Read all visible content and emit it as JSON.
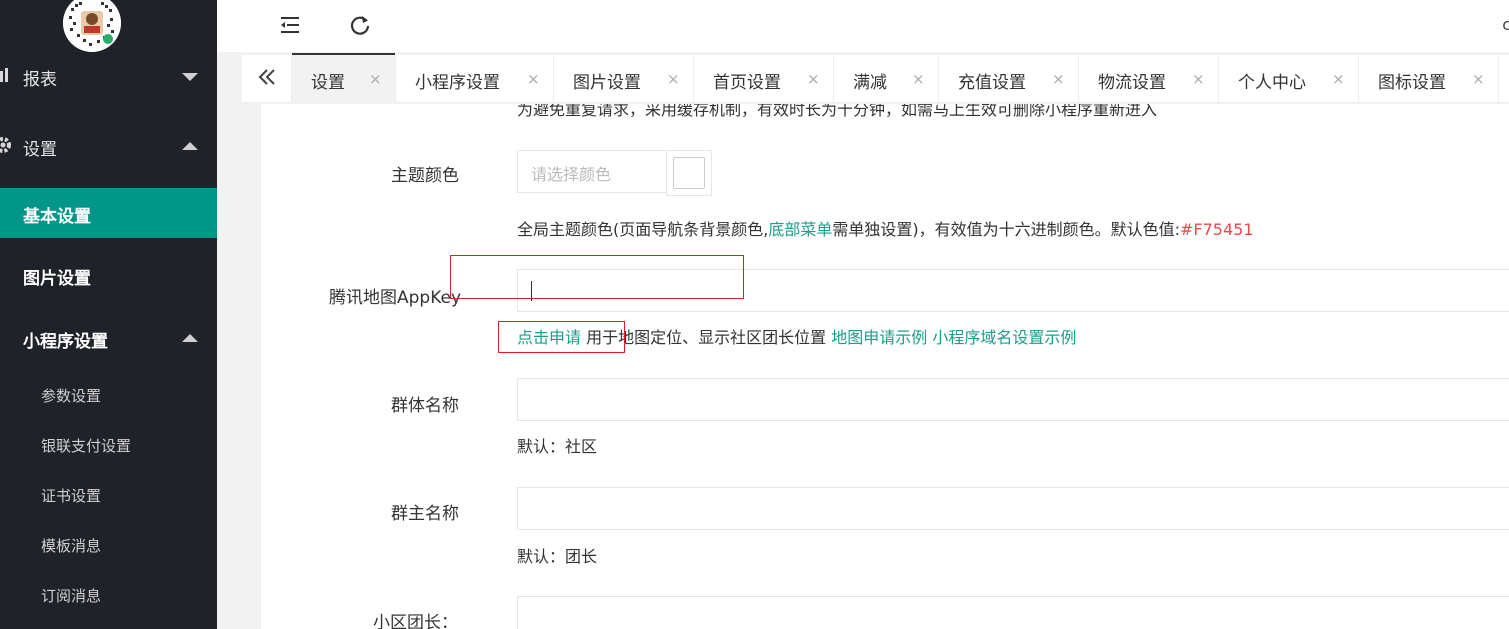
{
  "sidebar": {
    "items": [
      {
        "label": "报表"
      },
      {
        "label": "设置"
      },
      {
        "label": "基本设置"
      },
      {
        "label": "图片设置"
      },
      {
        "label": "小程序设置"
      },
      {
        "label": "参数设置"
      },
      {
        "label": "银联支付设置"
      },
      {
        "label": "证书设置"
      },
      {
        "label": "模板消息"
      },
      {
        "label": "订阅消息"
      }
    ]
  },
  "header": {
    "edge_text": "c"
  },
  "tabs": [
    {
      "label": "设置"
    },
    {
      "label": "小程序设置"
    },
    {
      "label": "图片设置"
    },
    {
      "label": "首页设置"
    },
    {
      "label": "满减"
    },
    {
      "label": "充值设置"
    },
    {
      "label": "物流设置"
    },
    {
      "label": "个人中心"
    },
    {
      "label": "图标设置"
    }
  ],
  "tab_close_glyph": "×",
  "form": {
    "cut_top_text": "为避免重复请求，采用缓存机制，有效时长为十分钟，如需马上生效可删除小程序重新进入",
    "theme_color": {
      "label": "主题颜色",
      "placeholder": "请选择颜色",
      "help_pre": "全局主题颜色(页面导航条背景颜色,",
      "help_link": "底部菜单",
      "help_mid": "需单独设置)，有效值为十六进制颜色。默认色值:",
      "help_value": "#F75451"
    },
    "map_key": {
      "label": "腾讯地图AppKey",
      "link_apply": "点击申请",
      "help_mid": "用于地图定位、显示社区团长位置",
      "link_example": "地图申请示例",
      "link_domain": "小程序域名设置示例"
    },
    "group_name": {
      "label": "群体名称",
      "help": "默认：社区"
    },
    "leader_name": {
      "label": "群主名称",
      "help": "默认：团长"
    },
    "community_leader": {
      "label": "小区团长："
    }
  },
  "colors": {
    "accent": "#009688",
    "link": "#1e9c8b",
    "value_red": "#f04848",
    "sidebar_bg": "#20222a"
  }
}
